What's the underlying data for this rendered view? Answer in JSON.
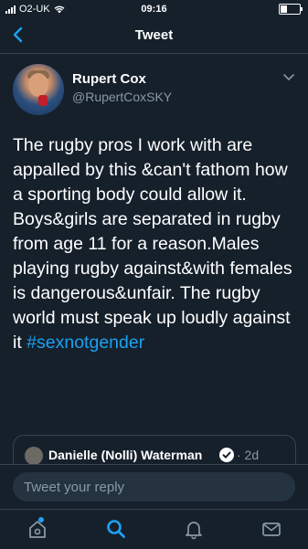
{
  "status_bar": {
    "carrier": "O2-UK",
    "time": "09:16"
  },
  "nav": {
    "title": "Tweet"
  },
  "author": {
    "name": "Rupert Cox",
    "handle": "@RupertCoxSKY"
  },
  "tweet": {
    "text": "The rugby pros I work with are appalled by this &can't fathom how a sporting body could allow it. Boys&girls are separated in rugby from age 11 for a reason.Males playing rugby against&with females is dangerous&unfair. The rugby world must speak up loudly against it",
    "hashtag": "#sexnotgender"
  },
  "quoted_tweet": {
    "name": "Danielle (Nolli) Waterman",
    "time": "· 2d"
  },
  "reply": {
    "placeholder": "Tweet your reply"
  },
  "tabs": [
    "home-icon",
    "search-icon",
    "notifications-icon",
    "messages-icon"
  ],
  "colors": {
    "background": "#15202b",
    "accent": "#1da1f2",
    "secondary_text": "#8899a6",
    "divider": "#38444d"
  }
}
